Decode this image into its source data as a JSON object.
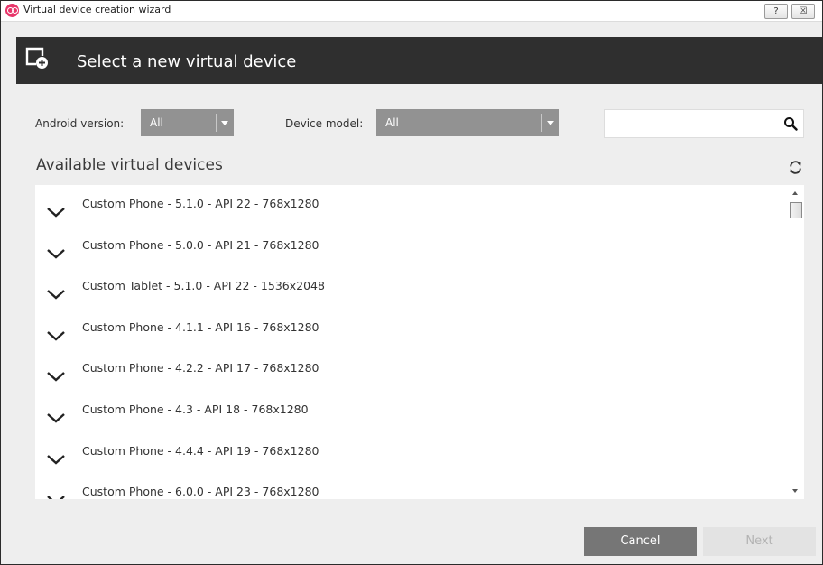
{
  "window": {
    "title": "Virtual device creation wizard",
    "help_label": "?",
    "close_label": "☒"
  },
  "header": {
    "title": "Select a new virtual device"
  },
  "filters": {
    "android_version_label": "Android version:",
    "android_version_value": "All",
    "device_model_label": "Device model:",
    "device_model_value": "All"
  },
  "search": {
    "value": "",
    "placeholder": ""
  },
  "list": {
    "title": "Available virtual devices",
    "items": [
      "Custom Phone - 5.1.0 - API 22 - 768x1280",
      "Custom Phone - 5.0.0 - API 21 - 768x1280",
      "Custom Tablet - 5.1.0 - API 22 - 1536x2048",
      "Custom Phone - 4.1.1 - API 16 - 768x1280",
      "Custom Phone - 4.2.2 - API 17 - 768x1280",
      "Custom Phone - 4.3 - API 18 - 768x1280",
      "Custom Phone - 4.4.4 - API 19 - 768x1280",
      "Custom Phone - 6.0.0 - API 23 - 768x1280"
    ]
  },
  "buttons": {
    "cancel": "Cancel",
    "next": "Next"
  },
  "colors": {
    "accent": "#e8356a",
    "header_bg": "#2f2f2f",
    "select_bg": "#929292",
    "cancel_bg": "#767676"
  }
}
